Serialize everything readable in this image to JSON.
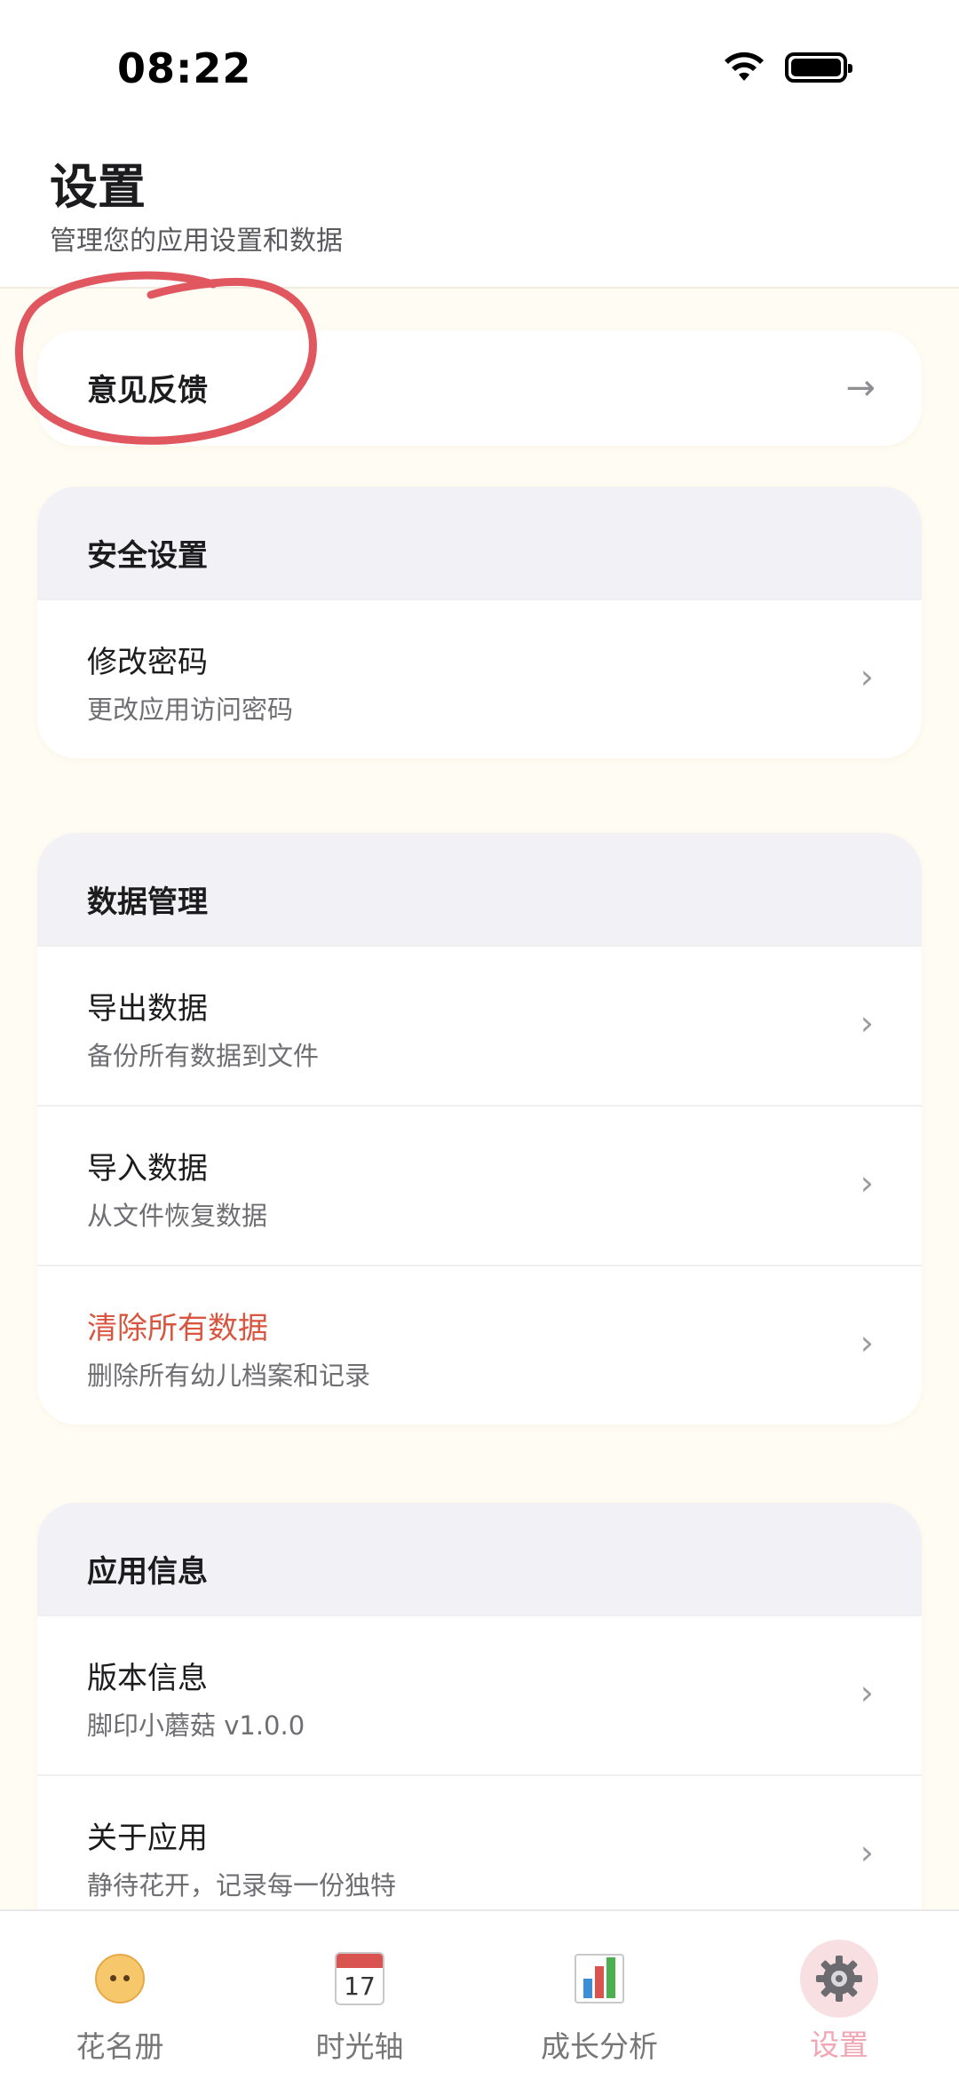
{
  "status_bar": {
    "time": "08:22"
  },
  "header": {
    "title": "设置",
    "subtitle": "管理您的应用设置和数据"
  },
  "feedback": {
    "label": "意见反馈",
    "arrow": "→"
  },
  "security": {
    "title": "安全设置",
    "items": [
      {
        "title": "修改密码",
        "subtitle": "更改应用访问密码"
      }
    ]
  },
  "data_management": {
    "title": "数据管理",
    "items": [
      {
        "title": "导出数据",
        "subtitle": "备份所有数据到文件"
      },
      {
        "title": "导入数据",
        "subtitle": "从文件恢复数据"
      },
      {
        "title": "清除所有数据",
        "subtitle": "删除所有幼儿档案和记录"
      }
    ]
  },
  "app_info": {
    "title": "应用信息",
    "items": [
      {
        "title": "版本信息",
        "subtitle": "脚印小蘑菇 v1.0.0"
      },
      {
        "title": "关于应用",
        "subtitle": "静待花开，记录每一份独特"
      }
    ]
  },
  "tab_bar": {
    "tabs": [
      {
        "label": "花名册",
        "icon": "baby-face-icon"
      },
      {
        "label": "时光轴",
        "icon": "calendar-icon",
        "icon_text": "17"
      },
      {
        "label": "成长分析",
        "icon": "bar-chart-icon"
      },
      {
        "label": "设置",
        "icon": "gear-icon",
        "active": true
      }
    ]
  },
  "colors": {
    "background": "#fffcf3",
    "danger": "#d8553f",
    "active_tab": "#f2a6b4",
    "annotation": "#e0575f"
  }
}
